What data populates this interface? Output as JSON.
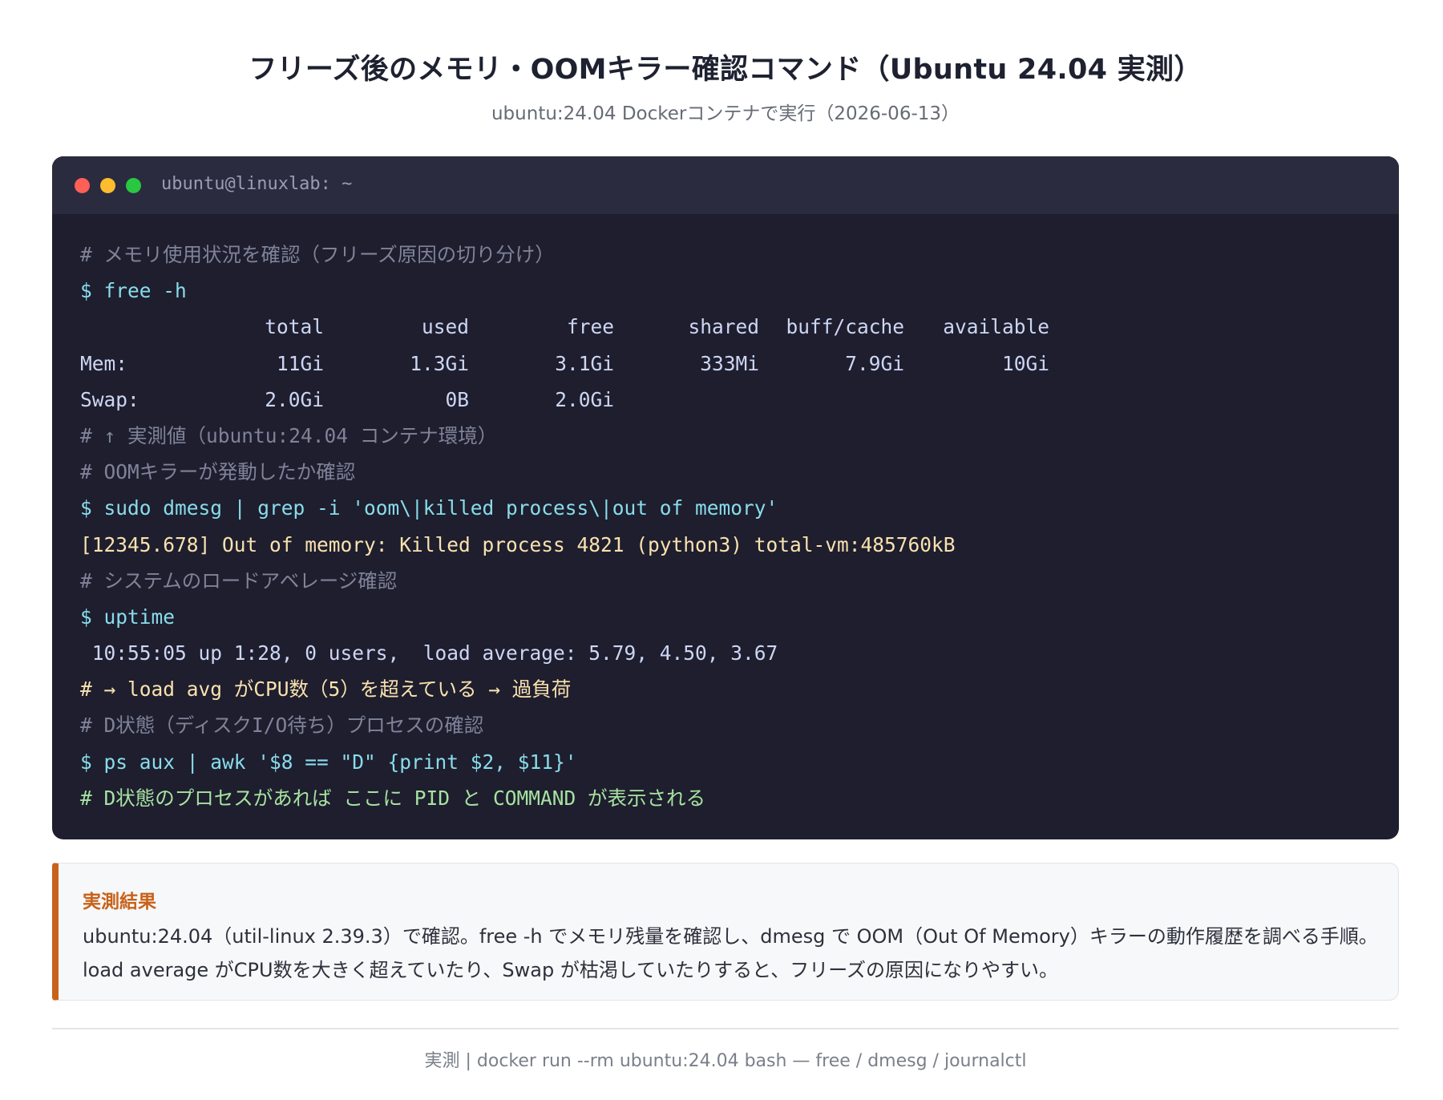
{
  "header": {
    "title": "フリーズ後のメモリ・OOMキラー確認コマンド（Ubuntu 24.04 実測）",
    "subtitle": "ubuntu:24.04 Dockerコンテナで実行（2026-06-13）"
  },
  "terminal": {
    "window_title": "ubuntu@linuxlab: ~",
    "window_controls": [
      "close",
      "minimize",
      "maximize"
    ],
    "lines": {
      "c1": "# メモリ使用状況を確認（フリーズ原因の切り分け）",
      "cmd1": "$ free -h",
      "c2": "# ↑ 実測値（ubuntu:24.04 コンテナ環境）",
      "c3": "# OOMキラーが発動したか確認",
      "cmd2": "$ sudo dmesg | grep -i 'oom\\|killed process\\|out of memory'",
      "out2": "[12345.678] Out of memory: Killed process 4821 (python3) total-vm:485760kB",
      "c4": "# システムのロードアベレージ確認",
      "cmd3": "$ uptime",
      "out3": " 10:55:05 up 1:28, 0 users,  load average: 5.79, 4.50, 3.67",
      "note3": "# → load avg がCPU数（5）を超えている → 過負荷",
      "c5": "# D状態（ディスクI/O待ち）プロセスの確認",
      "cmd4": "$ ps aux | awk '$8 == \"D\" {print $2, $11}'",
      "note4": "# D状態のプロセスがあれば ここに PID と COMMAND が表示される"
    },
    "free_table": {
      "headers": [
        "total",
        "used",
        "free",
        "shared",
        "buff/cache",
        "available"
      ],
      "mem": {
        "label": "Mem:",
        "total": "11Gi",
        "used": "1.3Gi",
        "free": "3.1Gi",
        "shared": "333Mi",
        "buff_cache": "7.9Gi",
        "available": "10Gi"
      },
      "swap": {
        "label": "Swap:",
        "total": "2.0Gi",
        "used": "0B",
        "free": "2.0Gi"
      }
    },
    "colors": {
      "background": "#1e1e2e",
      "titlebar": "#2a2b3f",
      "command": "#89dceb",
      "comment": "#7f8399",
      "output": "#cdd6f4",
      "warning": "#f9e2af",
      "success": "#a6e3a1"
    }
  },
  "result": {
    "heading": "実測結果",
    "text": "ubuntu:24.04（util-linux 2.39.3）で確認。free -h でメモリ残量を確認し、dmesg で OOM（Out Of Memory）キラーの動作履歴を調べる手順。load average がCPU数を大きく超えていたり、Swap が枯渇していたりすると、フリーズの原因になりやすい。",
    "accent_color": "#c8621a"
  },
  "footer": {
    "text": "実測 | docker run --rm ubuntu:24.04 bash — free / dmesg / journalctl"
  }
}
